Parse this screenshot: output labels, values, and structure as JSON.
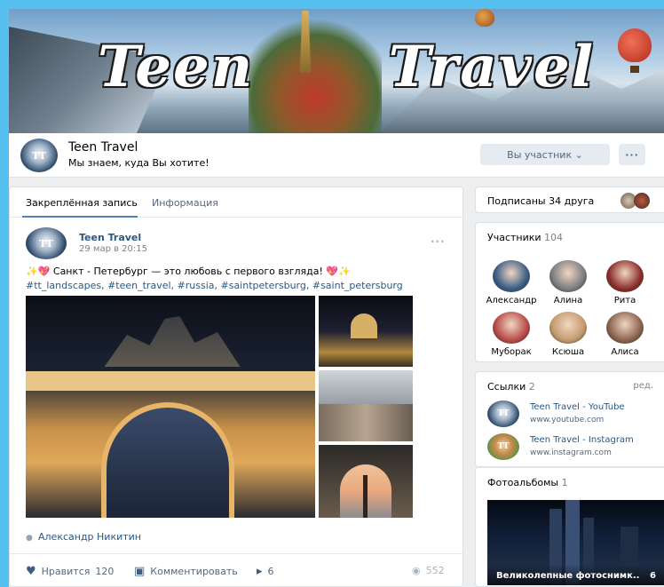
{
  "cover": {
    "title_word1": "Teen",
    "title_word2": "Travel"
  },
  "group": {
    "avatar_text": "TT",
    "name": "Teen Travel",
    "status": "Мы знаем, куда Вы хотите!",
    "member_button": "Вы участник ⌄",
    "more_button": "···"
  },
  "tabs": [
    {
      "label": "Закреплённая запись",
      "active": true
    },
    {
      "label": "Информация",
      "active": false
    }
  ],
  "post": {
    "author": "Teen Travel",
    "date": "29 мар в 20:15",
    "menu": "···",
    "text": "✨💖 Санкт - Петербург — это любовь с первого взгляда! 💖✨",
    "tags": "#tt_landscapes, #teen_travel, #russia, #saintpetersburg, #saint_petersburg",
    "signer": "Александр Никитин",
    "likes_label": "Нравится",
    "likes_count": "120",
    "comment_label": "Комментировать",
    "shares_count": "6",
    "views_count": "552"
  },
  "sidebar": {
    "friends": {
      "label": "Подписаны 34 друга"
    },
    "members": {
      "title": "Участники",
      "count": "104",
      "items": [
        {
          "name": "Александр",
          "color": "#3b5d85"
        },
        {
          "name": "Алина",
          "color": "#7d7d80"
        },
        {
          "name": "Рита",
          "color": "#8b2e2a"
        },
        {
          "name": "Муборак",
          "color": "#b84a4a"
        },
        {
          "name": "Ксюша",
          "color": "#c49a6c"
        },
        {
          "name": "Алиса",
          "color": "#8a6350"
        }
      ]
    },
    "links": {
      "title": "Ссылки",
      "count": "2",
      "edit": "ред.",
      "items": [
        {
          "avatar": "TT",
          "title": "Teen Travel - YouTube",
          "url": "www.youtube.com"
        },
        {
          "avatar": "TT",
          "title": "Teen Travel - Instagram",
          "url": "www.instagram.com"
        }
      ]
    },
    "albums": {
      "title": "Фотоальбомы",
      "count": "1",
      "items": [
        {
          "title": "Великолепные фотоснимк..",
          "count": "6"
        }
      ]
    }
  }
}
